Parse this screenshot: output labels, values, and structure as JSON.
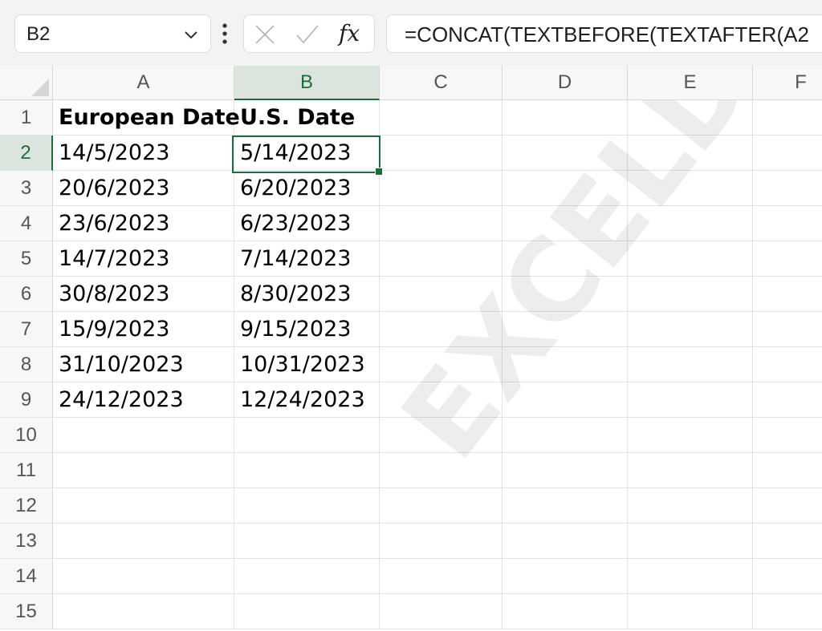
{
  "name_box": {
    "value": "B2"
  },
  "formula_bar": {
    "fx_label": "fx",
    "formula": "=CONCAT(TEXTBEFORE(TEXTAFTER(A2"
  },
  "columns": [
    "A",
    "B",
    "C",
    "D",
    "E",
    "F"
  ],
  "selected_column": "B",
  "rows": [
    "1",
    "2",
    "3",
    "4",
    "5",
    "6",
    "7",
    "8",
    "9",
    "10",
    "11",
    "12",
    "13",
    "14",
    "15"
  ],
  "selected_row": "2",
  "active_cell": "B2",
  "table": {
    "headers": [
      "European Date",
      "U.S. Date"
    ],
    "rows": [
      [
        "14/5/2023",
        "5/14/2023"
      ],
      [
        "20/6/2023",
        "6/20/2023"
      ],
      [
        "23/6/2023",
        "6/23/2023"
      ],
      [
        "14/7/2023",
        "7/14/2023"
      ],
      [
        "30/8/2023",
        "8/30/2023"
      ],
      [
        "15/9/2023",
        "9/15/2023"
      ],
      [
        "31/10/2023",
        "10/31/2023"
      ],
      [
        "24/12/2023",
        "12/24/2023"
      ]
    ]
  },
  "watermark": "EXCELDEMY.COM",
  "colors": {
    "accent": "#1e6b3b",
    "selected_header_bg": "#dbe4dd",
    "gridline": "#e3e3e3"
  }
}
